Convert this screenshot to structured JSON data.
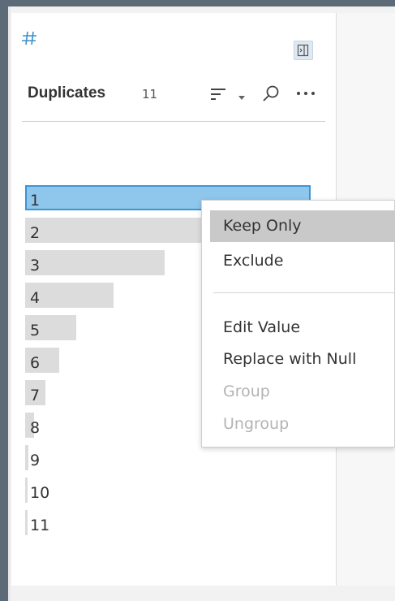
{
  "profile_card": {
    "field_type_icon": "hash-icon",
    "field_name": "Duplicates",
    "value_count": "11",
    "toolbar": {
      "collapse_icon": "collapse-panel-icon",
      "sort_icon": "sort-icon",
      "sort_dropdown_icon": "caret-down-icon",
      "search_icon": "search-icon",
      "more_icon": "more-options-icon"
    },
    "values": [
      {
        "label": "1",
        "frequency": 1.0,
        "selected": true
      },
      {
        "label": "2",
        "frequency": 0.62,
        "selected": false
      },
      {
        "label": "3",
        "frequency": 0.49,
        "selected": false
      },
      {
        "label": "4",
        "frequency": 0.31,
        "selected": false
      },
      {
        "label": "5",
        "frequency": 0.18,
        "selected": false
      },
      {
        "label": "6",
        "frequency": 0.12,
        "selected": false
      },
      {
        "label": "7",
        "frequency": 0.07,
        "selected": false
      },
      {
        "label": "8",
        "frequency": 0.03,
        "selected": false
      },
      {
        "label": "9",
        "frequency": 0.01,
        "selected": false
      },
      {
        "label": "10",
        "frequency": 0.005,
        "selected": false
      },
      {
        "label": "11",
        "frequency": 0.005,
        "selected": false
      }
    ],
    "colors": {
      "bar": "#dcdcdc",
      "selected_fill": "#8fc6ec",
      "selected_border": "#3c95d6",
      "field_icon": "#3a8fc9"
    }
  },
  "context_menu": {
    "items_group1": [
      "Keep Only",
      "Exclude"
    ],
    "items_group2": [
      "Edit Value",
      "Replace with Null",
      "Group",
      "Ungroup"
    ],
    "hover_item": "Keep Only",
    "disabled_items": [
      "Group",
      "Ungroup"
    ]
  }
}
